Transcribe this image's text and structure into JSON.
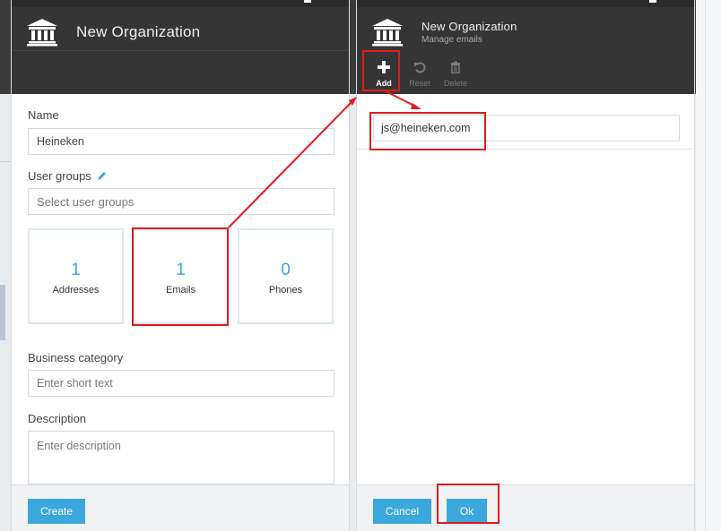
{
  "left_panel": {
    "title": "New Organization",
    "fields": {
      "name_label": "Name",
      "name_value": "Heineken",
      "user_groups_label": "User groups",
      "user_groups_placeholder": "Select user groups",
      "business_category_label": "Business category",
      "business_category_placeholder": "Enter short text",
      "description_label": "Description",
      "description_placeholder": "Enter description"
    },
    "stats": [
      {
        "count": "1",
        "label": "Addresses"
      },
      {
        "count": "1",
        "label": "Emails"
      },
      {
        "count": "0",
        "label": "Phones"
      }
    ],
    "footer": {
      "create_label": "Create"
    }
  },
  "right_panel": {
    "title": "New Organization",
    "subtitle": "Manage emails",
    "toolbar": {
      "add_label": "Add",
      "reset_label": "Reset",
      "delete_label": "Delete"
    },
    "emails": [
      "js@heineken.com"
    ],
    "footer": {
      "cancel_label": "Cancel",
      "ok_label": "Ok"
    }
  },
  "colors": {
    "accent": "#3aa8dd",
    "header_bg": "#353535",
    "annotation": "#e31b1b"
  },
  "icons": [
    "bank-icon",
    "pencil-icon",
    "plus-icon",
    "reset-icon",
    "trash-icon"
  ]
}
